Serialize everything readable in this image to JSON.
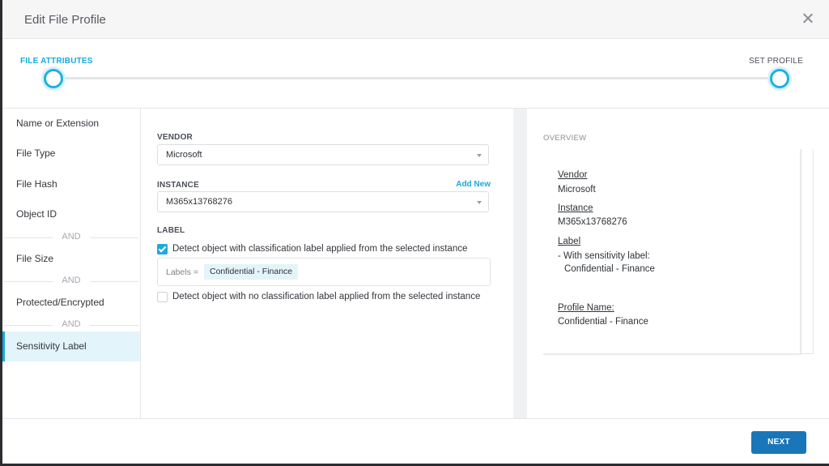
{
  "modal": {
    "title": "Edit File Profile"
  },
  "stepper": {
    "step1": "FILE ATTRIBUTES",
    "step2": "SET PROFILE"
  },
  "sidebar": {
    "items": [
      "Name or Extension",
      "File Type",
      "File Hash",
      "Object ID",
      "File Size",
      "Protected/Encrypted",
      "Sensitivity Label"
    ],
    "and_label": "AND",
    "active": "Sensitivity Label"
  },
  "form": {
    "vendor_label": "VENDOR",
    "vendor_value": "Microsoft",
    "instance_label": "INSTANCE",
    "add_new": "Add New",
    "instance_value": "M365x13768276",
    "label_section": "LABEL",
    "option1": "Detect object with classification label applied from the selected instance",
    "option1_checked": true,
    "labels_key": "Labels =",
    "label_chip": "Confidential - Finance",
    "option2": "Detect object with no classification label applied from the selected instance",
    "option2_checked": false
  },
  "overview": {
    "title": "OVERVIEW",
    "vendor_label": "Vendor",
    "vendor_value": "Microsoft",
    "instance_label": "Instance",
    "instance_value": "M365x13768276",
    "label_label": "Label",
    "label_line1": "- With sensitivity label:",
    "label_line2": "Confidential - Finance",
    "profile_label": "Profile Name:",
    "profile_value": "Confidential - Finance"
  },
  "footer": {
    "next": "NEXT"
  },
  "colors": {
    "accent": "#1aa9d9",
    "primary_button": "#1976b8"
  }
}
